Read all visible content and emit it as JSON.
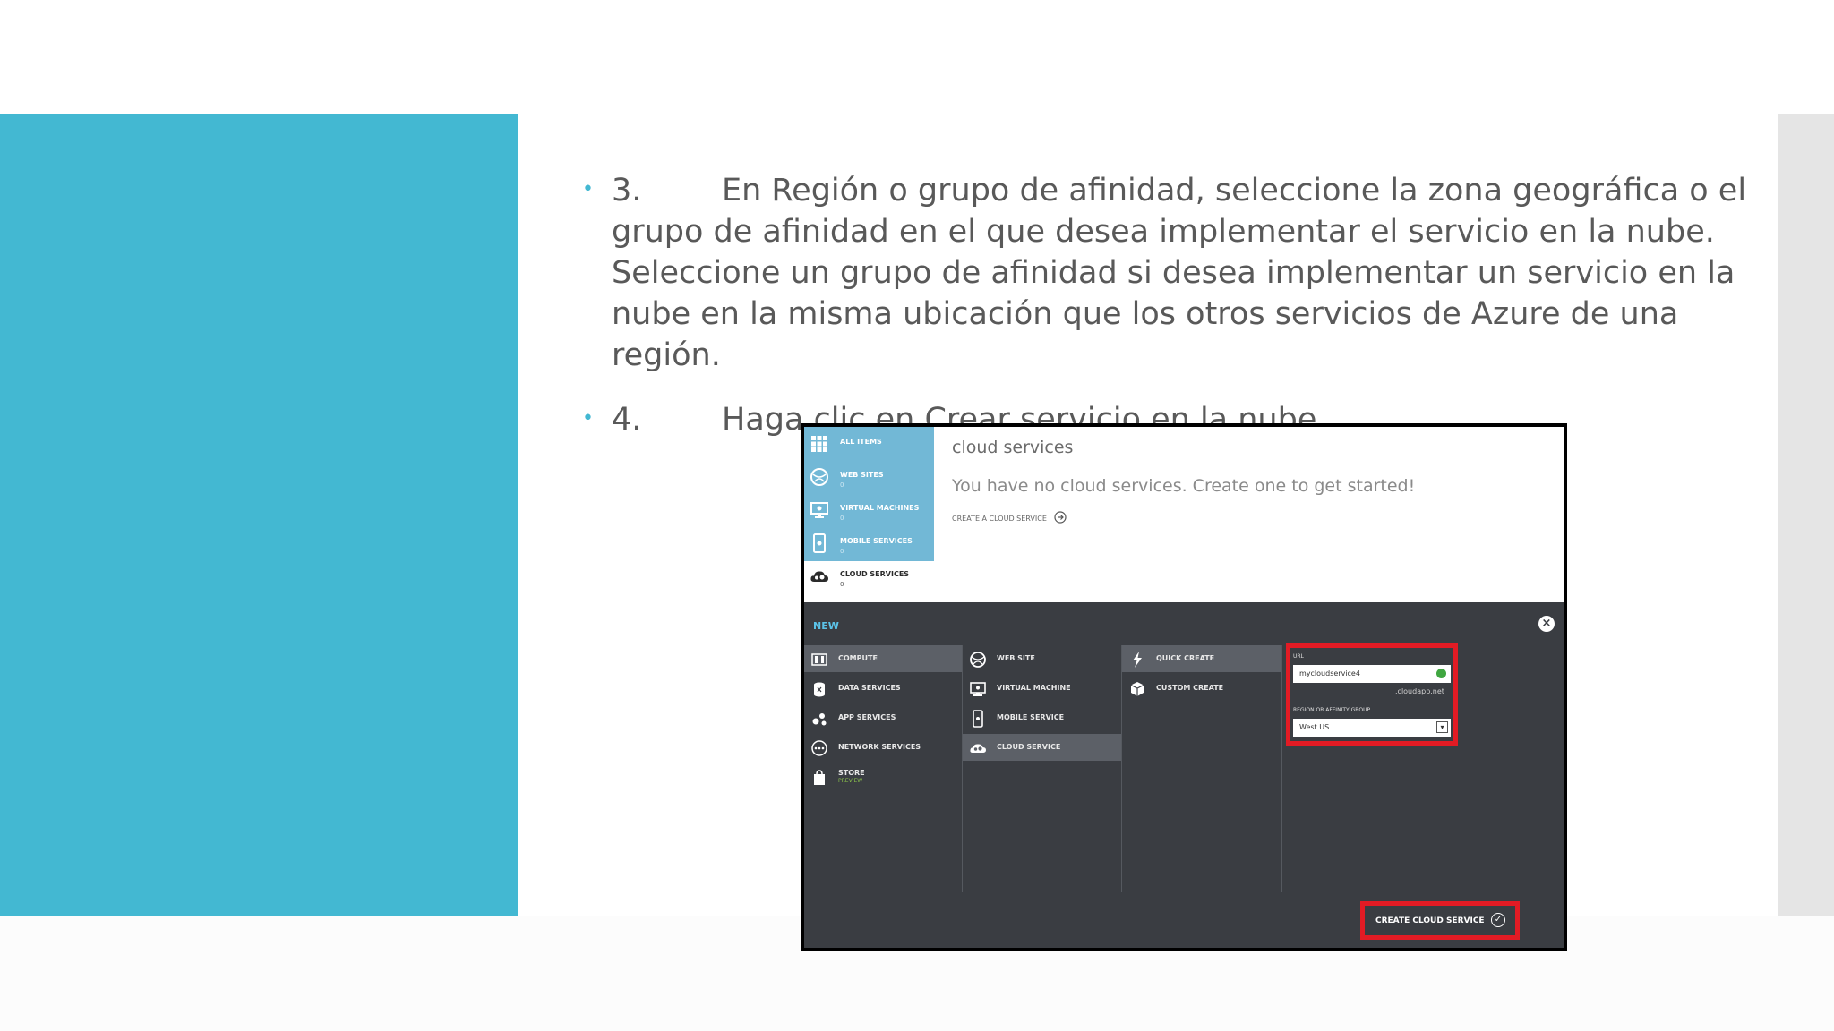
{
  "slide": {
    "bullets": [
      {
        "num": "3.",
        "text": "En Región o grupo de afinidad, seleccione la zona geográfica o el grupo de afinidad en el que desea implementar el servicio en la nube. Seleccione un grupo de afinidad si desea implementar un servicio en la nube en la misma ubicación que los otros servicios de Azure de una región."
      },
      {
        "num": "4.",
        "text": "Haga clic en Crear servicio en la nube."
      }
    ],
    "colors": {
      "accent": "#43b8d2",
      "text": "#595959",
      "side": "#e5e5e5"
    }
  },
  "portal": {
    "nav": [
      {
        "label": "ALL ITEMS",
        "count": "",
        "icon": "grid-icon"
      },
      {
        "label": "WEB SITES",
        "count": "0",
        "icon": "globe-icon"
      },
      {
        "label": "VIRTUAL MACHINES",
        "count": "0",
        "icon": "monitor-icon"
      },
      {
        "label": "MOBILE SERVICES",
        "count": "0",
        "icon": "mobile-icon"
      },
      {
        "label": "CLOUD SERVICES",
        "count": "0",
        "icon": "cloud-gears-icon"
      }
    ],
    "main": {
      "title": "cloud services",
      "message": "You have no cloud services. Create one to get started!",
      "create_link": "CREATE A CLOUD SERVICE"
    },
    "new_panel": {
      "label": "NEW",
      "close": "×",
      "col1": [
        {
          "label": "COMPUTE",
          "selected": true
        },
        {
          "label": "DATA SERVICES"
        },
        {
          "label": "APP SERVICES"
        },
        {
          "label": "NETWORK SERVICES"
        },
        {
          "label": "STORE",
          "sub": "PREVIEW"
        }
      ],
      "col2": [
        {
          "label": "WEB SITE"
        },
        {
          "label": "VIRTUAL MACHINE"
        },
        {
          "label": "MOBILE SERVICE"
        },
        {
          "label": "CLOUD SERVICE",
          "selected": true
        }
      ],
      "col3": [
        {
          "label": "QUICK CREATE",
          "selected": true
        },
        {
          "label": "CUSTOM CREATE"
        }
      ],
      "form": {
        "url_label": "URL",
        "url_value": "mycloudservice4",
        "domain_suffix": ".cloudapp.net",
        "region_label": "REGION OR AFFINITY GROUP",
        "region_value": "West US"
      },
      "create_button": "CREATE CLOUD SERVICE",
      "highlight_color": "#e21b24"
    }
  }
}
